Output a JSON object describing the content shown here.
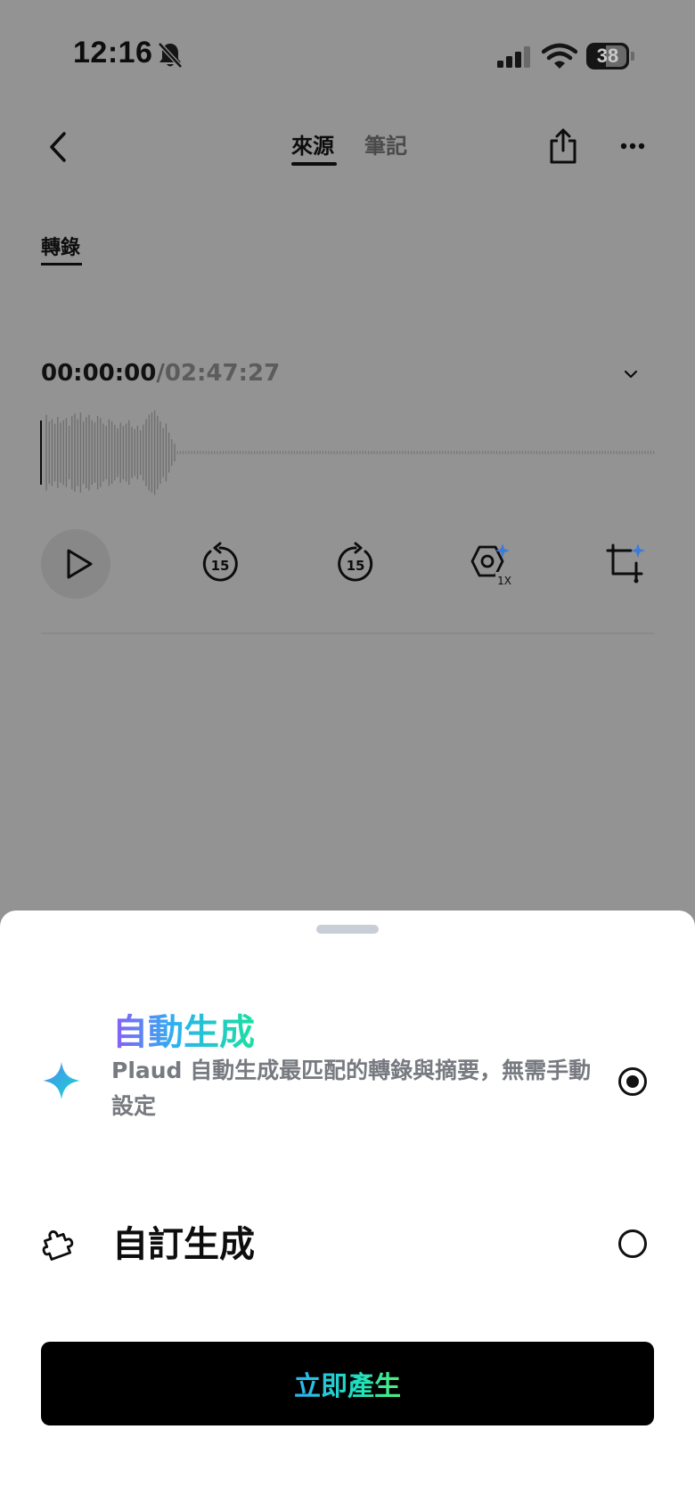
{
  "status_bar": {
    "time": "12:16",
    "battery_level": "38",
    "icons": [
      "bell-slash-icon",
      "cellular-signal-icon",
      "wifi-icon",
      "battery-icon"
    ]
  },
  "nav": {
    "tabs": [
      {
        "label": "來源",
        "active": true
      },
      {
        "label": "筆記",
        "active": false
      }
    ],
    "icons": [
      "back-chevron-icon",
      "share-icon",
      "more-icon"
    ]
  },
  "subtab": {
    "label": "轉錄"
  },
  "player": {
    "current_time": "00:00:00",
    "separator": "/",
    "total_time": "02:47:27",
    "speed_label": "1X",
    "skip_back_seconds": "15",
    "skip_forward_seconds": "15",
    "progress": 0.0
  },
  "sheet": {
    "auto": {
      "title": "自動生成",
      "description": "Plaud 自動生成最匹配的轉錄與摘要，無需手動設定",
      "selected": true
    },
    "custom": {
      "title": "自訂生成",
      "selected": false
    },
    "generate_button": "立即產生"
  },
  "colors": {
    "overlay": "#939393",
    "sheet_background": "#ffffff",
    "button_background": "#000000",
    "gradient_start": "#8a5cf5",
    "gradient_mid": "#2bb3f0",
    "gradient_end": "#19e0a0"
  }
}
